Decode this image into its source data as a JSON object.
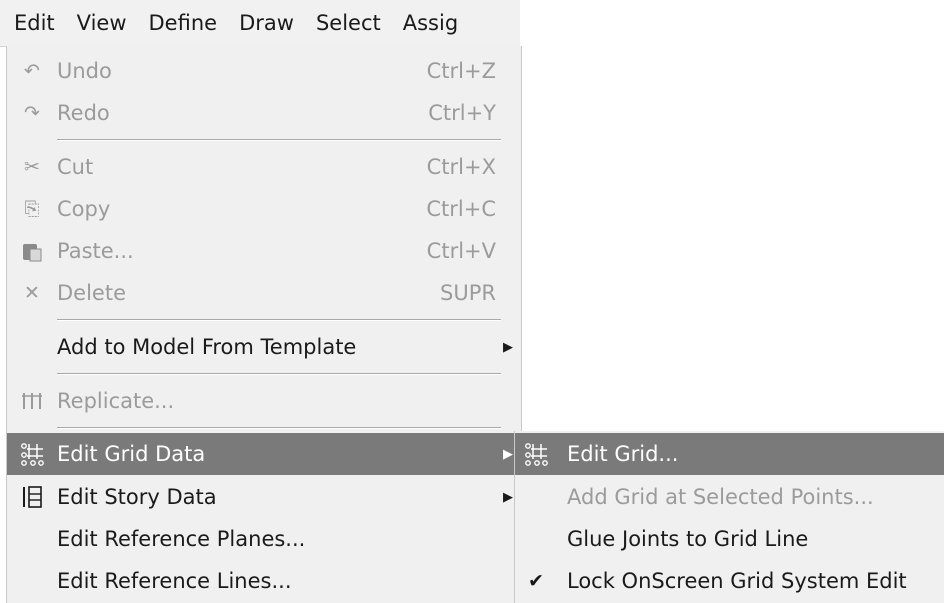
{
  "menubar": {
    "items": [
      "Edit",
      "View",
      "Define",
      "Draw",
      "Select",
      "Assig"
    ]
  },
  "edit_menu": {
    "items": [
      {
        "label": "Undo",
        "shortcut": "Ctrl+Z",
        "icon": "undo-icon"
      },
      {
        "label": "Redo",
        "shortcut": "Ctrl+Y",
        "icon": "redo-icon"
      },
      {
        "label": "Cut",
        "shortcut": "Ctrl+X",
        "icon": "cut-icon"
      },
      {
        "label": "Copy",
        "shortcut": "Ctrl+C",
        "icon": "copy-icon"
      },
      {
        "label": "Paste...",
        "shortcut": "Ctrl+V",
        "icon": "paste-icon"
      },
      {
        "label": "Delete",
        "shortcut": "SUPR",
        "icon": "delete-icon"
      },
      {
        "label": "Add to Model From Template"
      },
      {
        "label": "Replicate...",
        "icon": "replicate-icon"
      },
      {
        "label": "Edit Grid Data",
        "icon": "grid-icon"
      },
      {
        "label": "Edit Story Data",
        "icon": "story-icon"
      },
      {
        "label": "Edit Reference Planes..."
      },
      {
        "label": "Edit Reference Lines..."
      }
    ]
  },
  "grid_submenu": {
    "items": [
      {
        "label": "Edit Grid...",
        "icon": "grid-icon"
      },
      {
        "label": "Add Grid at Selected Points..."
      },
      {
        "label": "Glue Joints to Grid Line"
      },
      {
        "label": "Lock OnScreen Grid System Edit",
        "checked_icon": "checkmark-icon"
      }
    ]
  },
  "colors": {
    "menu_bg": "#f0f0f0",
    "highlight_bg": "#7a7a7a",
    "disabled_text": "#9b9b9b"
  }
}
